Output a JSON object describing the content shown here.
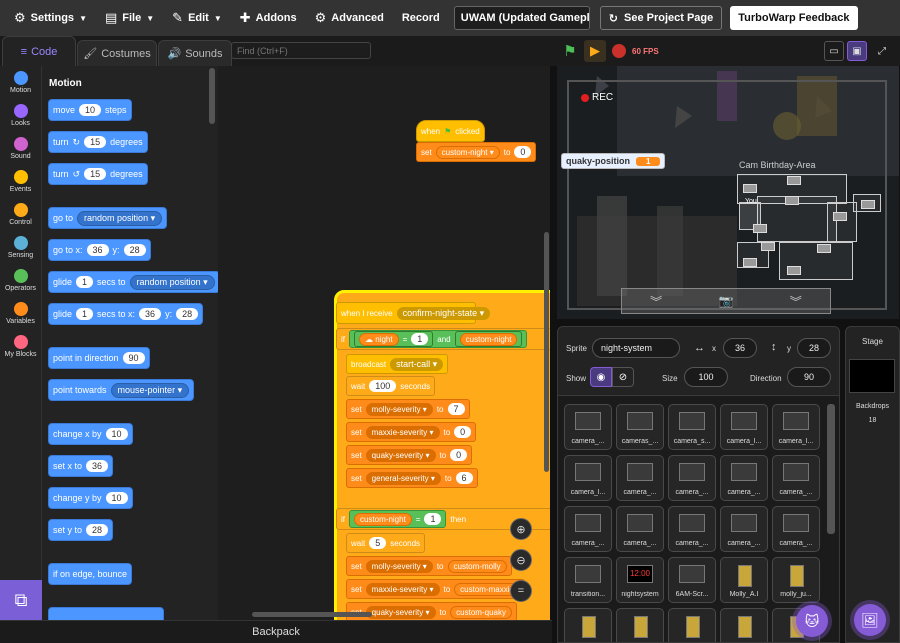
{
  "menubar": {
    "settings": "Settings",
    "file": "File",
    "edit": "Edit",
    "addons": "Addons",
    "advanced": "Advanced",
    "record": "Record",
    "project_title": "UWAM (Updated Gamepl...",
    "see_project_page": "See Project Page",
    "feedback": "TurboWarp Feedback"
  },
  "tabs": {
    "code": "Code",
    "costumes": "Costumes",
    "sounds": "Sounds"
  },
  "find": {
    "placeholder": "Find (Ctrl+F)"
  },
  "categories": [
    {
      "label": "Motion",
      "color": "#4c97ff"
    },
    {
      "label": "Looks",
      "color": "#9966ff"
    },
    {
      "label": "Sound",
      "color": "#cf63cf"
    },
    {
      "label": "Events",
      "color": "#ffbf00"
    },
    {
      "label": "Control",
      "color": "#ffab19"
    },
    {
      "label": "Sensing",
      "color": "#5cb1d6"
    },
    {
      "label": "Operators",
      "color": "#59c059"
    },
    {
      "label": "Variables",
      "color": "#ff8c1a"
    },
    {
      "label": "My Blocks",
      "color": "#ff6680"
    }
  ],
  "palette": {
    "title": "Motion",
    "move": {
      "a": "move",
      "n": "10",
      "b": "steps"
    },
    "turn_right": {
      "a": "turn",
      "n": "15",
      "b": "degrees"
    },
    "turn_left": {
      "a": "turn",
      "n": "15",
      "b": "degrees"
    },
    "goto": {
      "a": "go to",
      "opt": "random position"
    },
    "goto_xy": {
      "a": "go to x:",
      "x": "36",
      "b": "y:",
      "y": "28"
    },
    "glide_to": {
      "a": "glide",
      "n": "1",
      "b": "secs to",
      "opt": "random position"
    },
    "glide_xy": {
      "a": "glide",
      "n": "1",
      "b": "secs to x:",
      "x": "36",
      "c": "y:",
      "y": "28"
    },
    "point_dir": {
      "a": "point in direction",
      "n": "90"
    },
    "point_towards": {
      "a": "point towards",
      "opt": "mouse-pointer"
    },
    "change_x": {
      "a": "change x by",
      "n": "10"
    },
    "set_x": {
      "a": "set x to",
      "n": "36"
    },
    "change_y": {
      "a": "change y by",
      "n": "10"
    },
    "set_y": {
      "a": "set y to",
      "n": "28"
    },
    "bounce": {
      "a": "if on edge, bounce"
    }
  },
  "script1": {
    "hat_a": "when",
    "hat_b": "clicked",
    "set_a": "set",
    "set_var": "custom-night",
    "set_b": "to",
    "set_val": "0"
  },
  "script2": {
    "hat_a": "when I receive",
    "hat_msg": "confirm-night-state",
    "if_a": "if",
    "night": "night",
    "eq1": "=",
    "one": "1",
    "and": "and",
    "cn": "custom-night",
    "broadcast_a": "broadcast",
    "broadcast_msg": "start-call",
    "wait_a": "wait",
    "wait_n": "100",
    "wait_b": "seconds",
    "sets": [
      {
        "a": "set",
        "var": "molly-severity",
        "b": "to",
        "val": "7"
      },
      {
        "a": "set",
        "var": "maxxie-severity",
        "b": "to",
        "val": "0"
      },
      {
        "a": "set",
        "var": "quaky-severity",
        "b": "to",
        "val": "0"
      },
      {
        "a": "set",
        "var": "general-severity",
        "b": "to",
        "val": "6"
      }
    ],
    "if2_a": "if",
    "cn2": "custom-night",
    "eq2": "=",
    "one2": "1",
    "then": "then",
    "wait2_a": "wait",
    "wait2_n": "5",
    "wait2_b": "seconds",
    "sets2": [
      {
        "a": "set",
        "var": "molly-severity",
        "b": "to",
        "val": "custom-molly"
      },
      {
        "a": "set",
        "var": "maxxie-severity",
        "b": "to",
        "val": "custom-maxxie"
      },
      {
        "a": "set",
        "var": "quaky-severity",
        "b": "to",
        "val": "custom-quaky"
      }
    ]
  },
  "backpack": "Backpack",
  "stagebar": {
    "fps": "60 FPS"
  },
  "stage": {
    "rec": "REC",
    "monitor_label": "quaky-position",
    "monitor_value": "1",
    "cam_area": "Cam Birthday-Area",
    "you": "You"
  },
  "sprite_info": {
    "sprite_label": "Sprite",
    "sprite_name": "night-system",
    "x_label": "x",
    "x": "36",
    "y_label": "y",
    "y": "28",
    "show_label": "Show",
    "size_label": "Size",
    "size": "100",
    "direction_label": "Direction",
    "direction": "90"
  },
  "sprites": [
    "camera_...",
    "cameras_...",
    "camera_s...",
    "camera_l...",
    "camera_l...",
    "camera_l...",
    "camera_...",
    "camera_...",
    "camera_...",
    "camera_...",
    "camera_...",
    "camera_...",
    "camera_...",
    "camera_...",
    "camera_...",
    "transition...",
    "nightsystem",
    "6AM-Scr...",
    "Molly_A.I",
    "molly_ju...",
    "Maxxie_A.I",
    "maxxie_j...",
    "Quaky_A.I",
    "quaky_ju...",
    "camove..."
  ],
  "nightsystem_clock": "12:00",
  "stage_panel": {
    "title": "Stage",
    "backdrops_label": "Backdrops",
    "backdrops": "18"
  }
}
